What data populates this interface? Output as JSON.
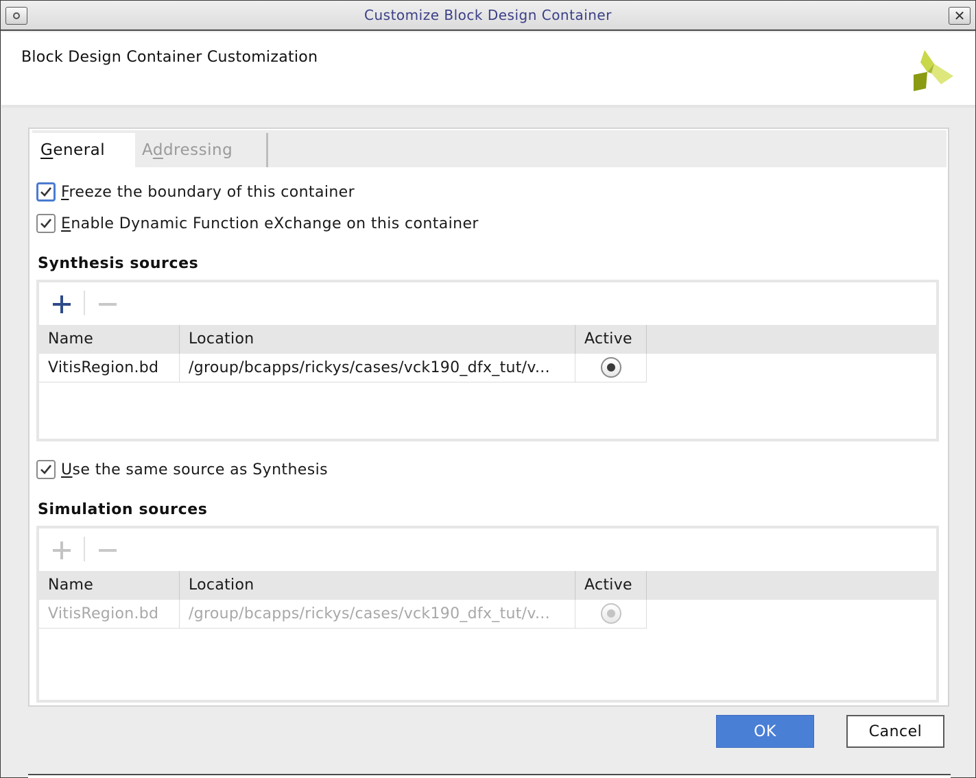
{
  "window": {
    "title": "Customize Block Design Container"
  },
  "header": {
    "heading": "Block Design Container Customization"
  },
  "tabs": [
    {
      "label_ul": "G",
      "label_rest": "eneral",
      "active": true
    },
    {
      "label_pre": "A",
      "label_ul": "d",
      "label_rest": "dressing",
      "active": false
    }
  ],
  "options": {
    "freeze": {
      "ul": "F",
      "rest": "reeze the boundary of this container",
      "checked": true
    },
    "dfx": {
      "ul": "E",
      "rest": "nable Dynamic Function eXchange on this container",
      "checked": true
    },
    "same_source": {
      "ul": "U",
      "rest": "se the same source as Synthesis",
      "checked": true
    }
  },
  "synthesis": {
    "title": "Synthesis sources",
    "columns": {
      "name": "Name",
      "location": "Location",
      "active": "Active"
    },
    "rows": [
      {
        "name": "VitisRegion.bd",
        "location": "/group/bcapps/rickys/cases/vck190_dfx_tut/v...",
        "active": true
      }
    ]
  },
  "simulation": {
    "title": "Simulation sources",
    "columns": {
      "name": "Name",
      "location": "Location",
      "active": "Active"
    },
    "rows": [
      {
        "name": "VitisRegion.bd",
        "location": "/group/bcapps/rickys/cases/vck190_dfx_tut/v...",
        "active": true
      }
    ]
  },
  "buttons": {
    "ok": "OK",
    "cancel": "Cancel"
  },
  "colors": {
    "accent": "#4a7fd6",
    "title_text": "#3b3f86",
    "logo_dark": "#8a9a12",
    "logo_light": "#c9d84a"
  },
  "icons": {
    "add": "plus-icon",
    "remove": "minus-icon",
    "logo": "xilinx-logo-icon"
  }
}
